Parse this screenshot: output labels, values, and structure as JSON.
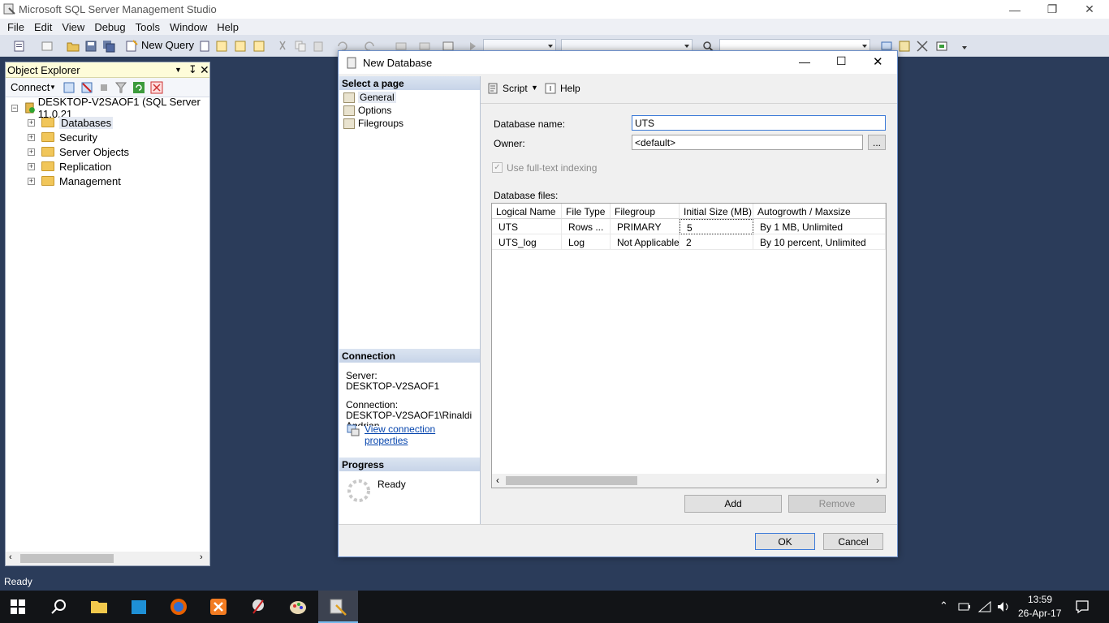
{
  "app": {
    "title": "Microsoft SQL Server Management Studio"
  },
  "menu": [
    "File",
    "Edit",
    "View",
    "Debug",
    "Tools",
    "Window",
    "Help"
  ],
  "toolbar": {
    "new_query_label": "New Query"
  },
  "object_explorer": {
    "title": "Object Explorer",
    "connect_label": "Connect",
    "server_node": "DESKTOP-V2SAOF1 (SQL Server 11.0.21",
    "items": [
      "Databases",
      "Security",
      "Server Objects",
      "Replication",
      "Management"
    ]
  },
  "status": {
    "text": "Ready"
  },
  "dialog": {
    "title": "New Database",
    "select_page_header": "Select a page",
    "pages": [
      "General",
      "Options",
      "Filegroups"
    ],
    "script_label": "Script",
    "help_label": "Help",
    "db_name_label": "Database name:",
    "db_name_value": "UTS",
    "owner_label": "Owner:",
    "owner_value": "<default>",
    "browse_label": "...",
    "fulltext_label": "Use full-text indexing",
    "db_files_label": "Database files:",
    "columns": [
      "Logical Name",
      "File Type",
      "Filegroup",
      "Initial Size (MB)",
      "Autogrowth / Maxsize"
    ],
    "rows": [
      [
        "UTS",
        "Rows ...",
        "PRIMARY",
        "5",
        "By 1 MB, Unlimited"
      ],
      [
        "UTS_log",
        "Log",
        "Not Applicable",
        "2",
        "By 10 percent, Unlimited"
      ]
    ],
    "connection_header": "Connection",
    "server_label": "Server:",
    "server_value": "DESKTOP-V2SAOF1",
    "connection_label": "Connection:",
    "connection_value": "DESKTOP-V2SAOF1\\Rinaldi",
    "connection_value_cut": "Andrian",
    "view_conn_props": "View connection properties",
    "progress_header": "Progress",
    "progress_status": "Ready",
    "add_label": "Add",
    "remove_label": "Remove",
    "ok_label": "OK",
    "cancel_label": "Cancel"
  },
  "tray": {
    "time": "13:59",
    "date": "26-Apr-17"
  }
}
